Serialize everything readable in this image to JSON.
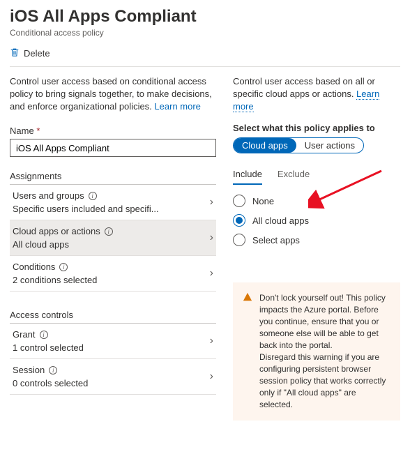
{
  "header": {
    "title": "iOS All Apps Compliant",
    "subtitle": "Conditional access policy"
  },
  "toolbar": {
    "delete_label": "Delete"
  },
  "left": {
    "intro_text": "Control user access based on conditional access policy to bring signals together, to make decisions, and enforce organizational policies. ",
    "intro_learn_more": "Learn more",
    "name_label": "Name",
    "name_value": "iOS All Apps Compliant",
    "assignments_title": "Assignments",
    "items": [
      {
        "label": "Users and groups",
        "sub": "Specific users included and specifi..."
      },
      {
        "label": "Cloud apps or actions",
        "sub": "All cloud apps"
      },
      {
        "label": "Conditions",
        "sub": "2 conditions selected"
      }
    ],
    "access_controls_title": "Access controls",
    "ac_items": [
      {
        "label": "Grant",
        "sub": "1 control selected"
      },
      {
        "label": "Session",
        "sub": "0 controls selected"
      }
    ]
  },
  "right": {
    "intro_text": "Control user access based on all or specific cloud apps or actions. ",
    "intro_learn_more": "Learn more",
    "applies_heading": "Select what this policy applies to",
    "pill_cloud": "Cloud apps",
    "pill_user_actions": "User actions",
    "tab_include": "Include",
    "tab_exclude": "Exclude",
    "radio_none": "None",
    "radio_all": "All cloud apps",
    "radio_select": "Select apps",
    "warning_text": "Don't lock yourself out! This policy impacts the Azure portal. Before you continue, ensure that you or someone else will be able to get back into the portal.\nDisregard this warning if you are configuring persistent browser session policy that works correctly only if \"All cloud apps\" are selected."
  }
}
